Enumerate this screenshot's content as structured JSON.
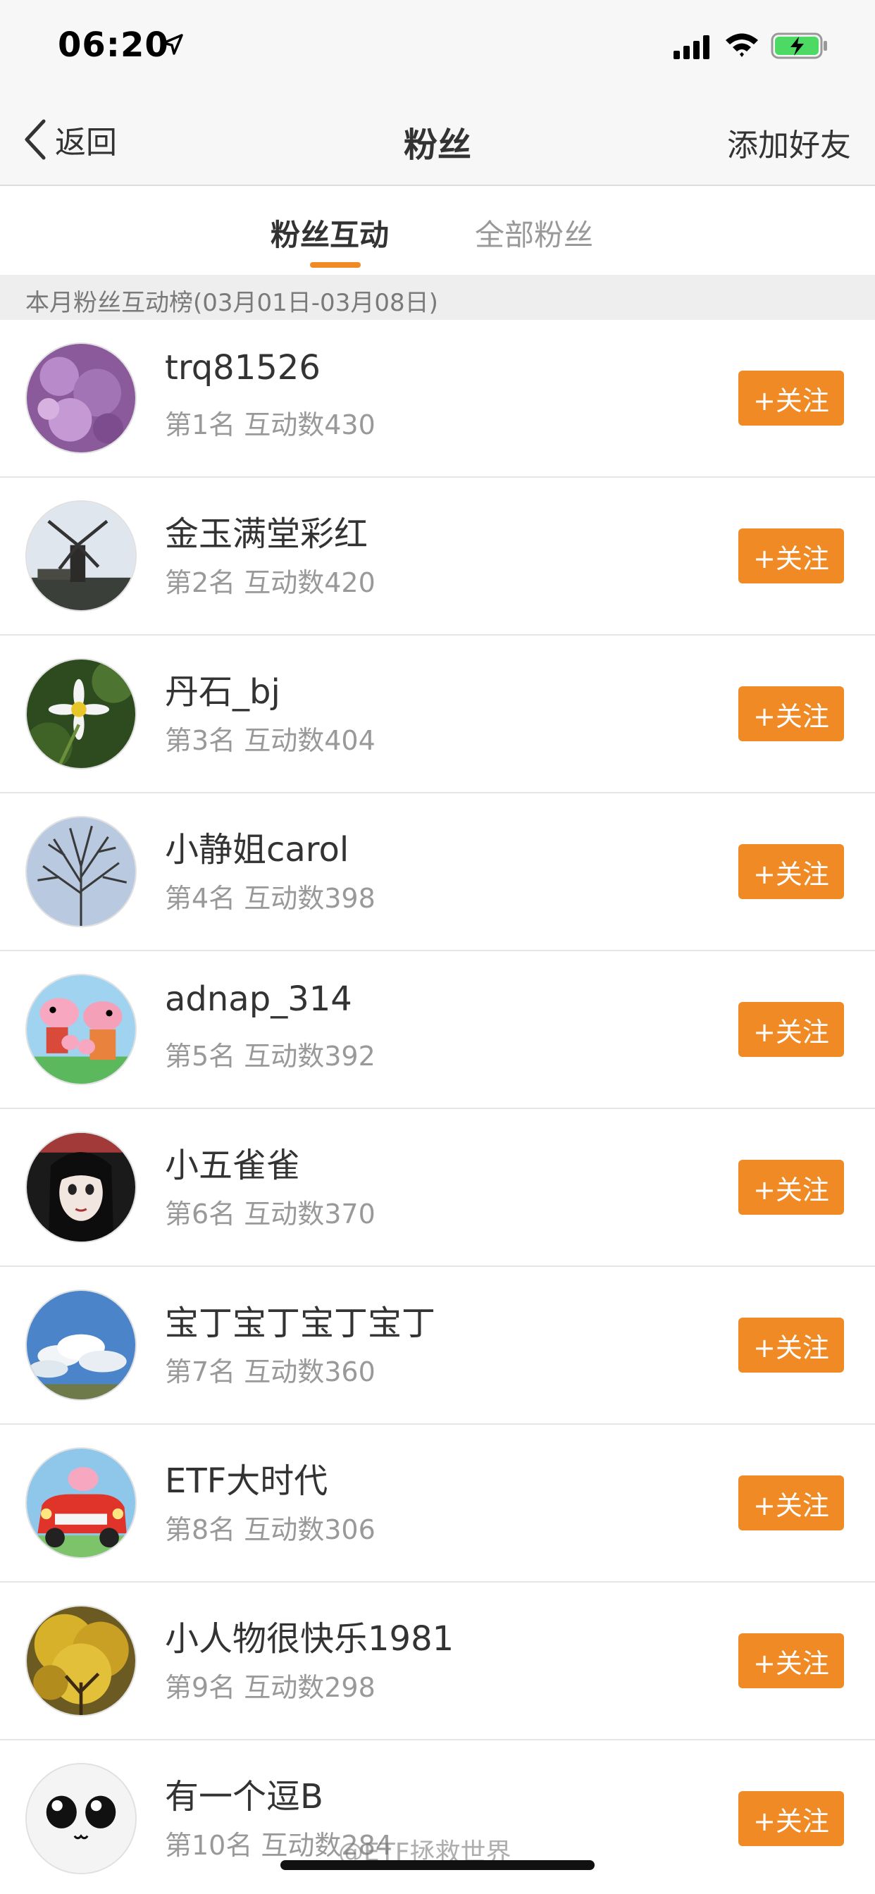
{
  "status_bar": {
    "time": "06:20"
  },
  "nav": {
    "back_label": "返回",
    "title": "粉丝",
    "right_action": "添加好友"
  },
  "tabs": [
    {
      "label": "粉丝互动",
      "active": true
    },
    {
      "label": "全部粉丝",
      "active": false
    }
  ],
  "section_header": "本月粉丝互动榜(03月01日-03月08日)",
  "follow_label": "+关注",
  "fans": [
    {
      "name": "trq81526",
      "meta": "第1名 互动数430"
    },
    {
      "name": "金玉满堂彩红",
      "meta": "第2名 互动数420"
    },
    {
      "name": "丹石_bj",
      "meta": "第3名 互动数404"
    },
    {
      "name": "小静姐carol",
      "meta": "第4名 互动数398"
    },
    {
      "name": "adnap_314",
      "meta": "第5名 互动数392"
    },
    {
      "name": "小五雀雀",
      "meta": "第6名 互动数370"
    },
    {
      "name": "宝丁宝丁宝丁宝丁",
      "meta": "第7名 互动数360"
    },
    {
      "name": "ETF大时代",
      "meta": "第8名 互动数306"
    },
    {
      "name": "小人物很快乐1981",
      "meta": "第9名 互动数298"
    },
    {
      "name": "有一个逗B",
      "meta": "第10名 互动数284"
    }
  ],
  "watermark": "@ETF拯救世界",
  "colors": {
    "accent": "#f08a24"
  }
}
